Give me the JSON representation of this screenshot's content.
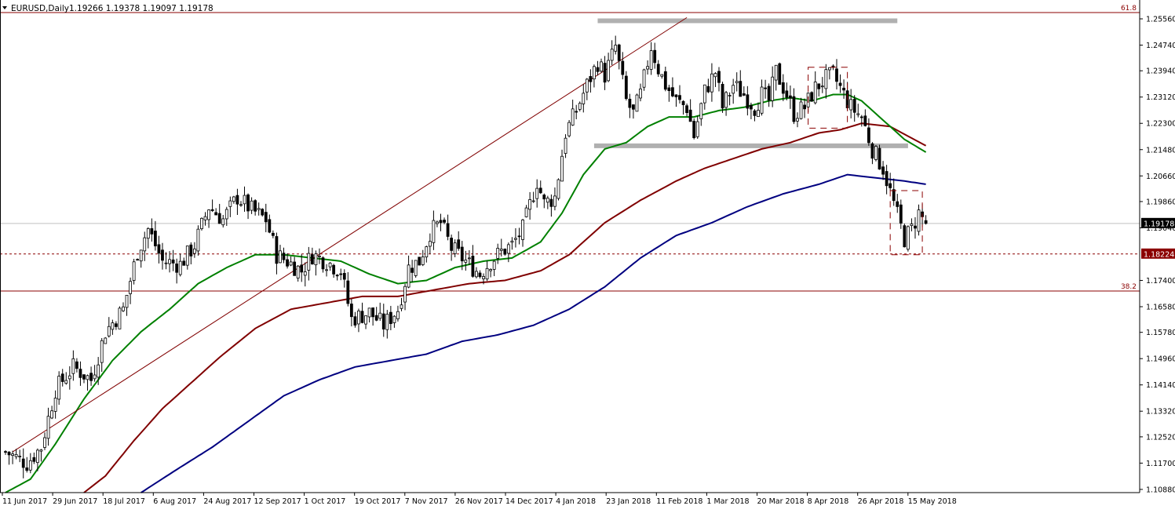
{
  "header": {
    "symbol": "EURUSD,Daily",
    "ohlc": "1.19266 1.19378 1.19097 1.19178"
  },
  "colors": {
    "background": "#ffffff",
    "axis": "#000000",
    "candle_up_body": "#ffffff",
    "candle_down_body": "#000000",
    "candle_wick": "#000000",
    "ma_fast": "#008000",
    "ma_mid": "#800000",
    "ma_slow": "#000080",
    "trendline": "#800000",
    "fib_line": "#8b0000",
    "support_resistance": "#b0b0b0",
    "dashed_level": "#8b0000",
    "current_price_label_bg": "#000000",
    "dashed_level_label_bg": "#8b0000"
  },
  "chart_data": {
    "type": "candlestick",
    "title": "EURUSD,Daily",
    "ylim": [
      1.1078,
      1.2605
    ],
    "y_ticks": [
      "1.25560",
      "1.24740",
      "1.23940",
      "1.23120",
      "1.22300",
      "1.21480",
      "1.20660",
      "1.19860",
      "1.19040",
      "1.18224",
      "1.17400",
      "1.16580",
      "1.15780",
      "1.14960",
      "1.14140",
      "1.13320",
      "1.12520",
      "1.11700",
      "1.10880"
    ],
    "x_ticks": [
      "11 Jun 2017",
      "29 Jun 2017",
      "18 Jul 2017",
      "6 Aug 2017",
      "24 Aug 2017",
      "12 Sep 2017",
      "1 Oct 2017",
      "19 Oct 2017",
      "7 Nov 2017",
      "26 Nov 2017",
      "14 Dec 2017",
      "4 Jan 2018",
      "23 Jan 2018",
      "11 Feb 2018",
      "1 Mar 2018",
      "20 Mar 2018",
      "8 Apr 2018",
      "26 Apr 2018",
      "15 May 2018"
    ],
    "current_price": {
      "value": 1.19178,
      "label": "1.19178"
    },
    "level_label": {
      "value": 1.18224,
      "label": "1.18224"
    },
    "fib_levels": [
      {
        "label": "61.8",
        "value": 1.2615
      },
      {
        "label": "38.2",
        "value": 1.1707
      }
    ],
    "close_anchors": [
      [
        0,
        1.1205
      ],
      [
        6,
        1.117
      ],
      [
        10,
        1.122
      ],
      [
        14,
        1.14
      ],
      [
        19,
        1.147
      ],
      [
        24,
        1.143
      ],
      [
        28,
        1.158
      ],
      [
        33,
        1.165
      ],
      [
        37,
        1.183
      ],
      [
        40,
        1.19
      ],
      [
        44,
        1.18
      ],
      [
        49,
        1.179
      ],
      [
        53,
        1.185
      ],
      [
        57,
        1.197
      ],
      [
        61,
        1.193
      ],
      [
        65,
        1.2
      ],
      [
        69,
        1.196
      ],
      [
        73,
        1.193
      ],
      [
        76,
        1.182
      ],
      [
        79,
        1.18
      ],
      [
        83,
        1.177
      ],
      [
        86,
        1.182
      ],
      [
        90,
        1.18
      ],
      [
        94,
        1.177
      ],
      [
        97,
        1.162
      ],
      [
        102,
        1.164
      ],
      [
        106,
        1.16
      ],
      [
        110,
        1.165
      ],
      [
        113,
        1.178
      ],
      [
        116,
        1.18
      ],
      [
        119,
        1.189
      ],
      [
        122,
        1.192
      ],
      [
        125,
        1.184
      ],
      [
        129,
        1.18
      ],
      [
        133,
        1.176
      ],
      [
        136,
        1.18
      ],
      [
        139,
        1.183
      ],
      [
        142,
        1.185
      ],
      [
        145,
        1.19
      ],
      [
        149,
        1.205
      ],
      [
        151,
        1.198
      ],
      [
        154,
        1.2
      ],
      [
        157,
        1.22
      ],
      [
        160,
        1.227
      ],
      [
        163,
        1.235
      ],
      [
        166,
        1.242
      ],
      [
        168,
        1.238
      ],
      [
        171,
        1.247
      ],
      [
        174,
        1.23
      ],
      [
        176,
        1.226
      ],
      [
        178,
        1.232
      ],
      [
        181,
        1.247
      ],
      [
        183,
        1.24
      ],
      [
        185,
        1.235
      ],
      [
        188,
        1.23
      ],
      [
        191,
        1.228
      ],
      [
        193,
        1.219
      ],
      [
        196,
        1.233
      ],
      [
        199,
        1.239
      ],
      [
        201,
        1.228
      ],
      [
        204,
        1.235
      ],
      [
        207,
        1.232
      ],
      [
        210,
        1.228
      ],
      [
        212,
        1.232
      ],
      [
        214,
        1.23
      ],
      [
        216,
        1.239
      ],
      [
        219,
        1.232
      ],
      [
        221,
        1.226
      ],
      [
        224,
        1.228
      ],
      [
        227,
        1.234
      ],
      [
        230,
        1.237
      ],
      [
        232,
        1.238
      ],
      [
        234,
        1.234
      ],
      [
        237,
        1.228
      ],
      [
        240,
        1.225
      ],
      [
        243,
        1.215
      ],
      [
        246,
        1.209
      ],
      [
        249,
        1.198
      ],
      [
        252,
        1.187
      ],
      [
        254,
        1.19
      ],
      [
        256,
        1.195
      ],
      [
        258,
        1.1918
      ]
    ],
    "ma_fast_anchors": [
      [
        0,
        1.1078
      ],
      [
        7,
        1.112
      ],
      [
        14,
        1.123
      ],
      [
        22,
        1.137
      ],
      [
        30,
        1.149
      ],
      [
        38,
        1.158
      ],
      [
        46,
        1.165
      ],
      [
        54,
        1.173
      ],
      [
        62,
        1.178
      ],
      [
        70,
        1.182
      ],
      [
        78,
        1.182
      ],
      [
        86,
        1.181
      ],
      [
        94,
        1.18
      ],
      [
        102,
        1.176
      ],
      [
        110,
        1.173
      ],
      [
        118,
        1.174
      ],
      [
        126,
        1.178
      ],
      [
        134,
        1.18
      ],
      [
        142,
        1.181
      ],
      [
        150,
        1.186
      ],
      [
        156,
        1.195
      ],
      [
        162,
        1.207
      ],
      [
        168,
        1.215
      ],
      [
        174,
        1.217
      ],
      [
        180,
        1.222
      ],
      [
        186,
        1.225
      ],
      [
        193,
        1.225
      ],
      [
        200,
        1.227
      ],
      [
        207,
        1.228
      ],
      [
        214,
        1.23
      ],
      [
        220,
        1.231
      ],
      [
        226,
        1.23
      ],
      [
        232,
        1.232
      ],
      [
        236,
        1.232
      ],
      [
        240,
        1.23
      ],
      [
        246,
        1.224
      ],
      [
        252,
        1.218
      ],
      [
        258,
        1.214
      ]
    ],
    "ma_mid_anchors": [
      [
        22,
        1.1078
      ],
      [
        28,
        1.113
      ],
      [
        36,
        1.124
      ],
      [
        44,
        1.134
      ],
      [
        52,
        1.142
      ],
      [
        60,
        1.15
      ],
      [
        70,
        1.159
      ],
      [
        80,
        1.165
      ],
      [
        90,
        1.167
      ],
      [
        100,
        1.169
      ],
      [
        110,
        1.169
      ],
      [
        120,
        1.171
      ],
      [
        130,
        1.173
      ],
      [
        140,
        1.174
      ],
      [
        150,
        1.177
      ],
      [
        158,
        1.182
      ],
      [
        168,
        1.192
      ],
      [
        178,
        1.199
      ],
      [
        188,
        1.205
      ],
      [
        196,
        1.209
      ],
      [
        204,
        1.212
      ],
      [
        212,
        1.215
      ],
      [
        220,
        1.217
      ],
      [
        228,
        1.22
      ],
      [
        234,
        1.221
      ],
      [
        240,
        1.223
      ],
      [
        248,
        1.222
      ],
      [
        258,
        1.216
      ]
    ],
    "ma_slow_anchors": [
      [
        38,
        1.1078
      ],
      [
        48,
        1.115
      ],
      [
        58,
        1.122
      ],
      [
        68,
        1.13
      ],
      [
        78,
        1.138
      ],
      [
        88,
        1.143
      ],
      [
        98,
        1.147
      ],
      [
        108,
        1.149
      ],
      [
        118,
        1.151
      ],
      [
        128,
        1.155
      ],
      [
        138,
        1.157
      ],
      [
        148,
        1.16
      ],
      [
        158,
        1.165
      ],
      [
        168,
        1.172
      ],
      [
        178,
        1.181
      ],
      [
        188,
        1.188
      ],
      [
        198,
        1.192
      ],
      [
        208,
        1.197
      ],
      [
        218,
        1.201
      ],
      [
        228,
        1.204
      ],
      [
        236,
        1.207
      ],
      [
        244,
        1.206
      ],
      [
        252,
        1.205
      ],
      [
        258,
        1.204
      ]
    ],
    "trendline": [
      [
        2,
        1.1205
      ],
      [
        191,
        1.256
      ]
    ],
    "resistance_zone": [
      [
        166,
        1.255
      ],
      [
        250,
        1.255
      ]
    ],
    "support_zone": [
      [
        165,
        1.216
      ],
      [
        253,
        1.216
      ]
    ]
  }
}
